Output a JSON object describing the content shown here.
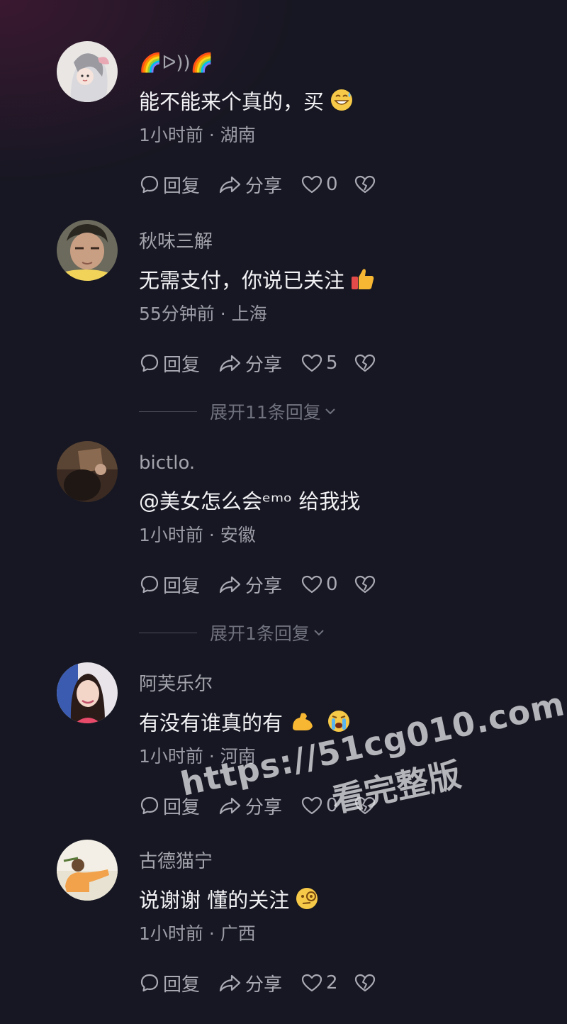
{
  "actions": {
    "reply_label": "回复",
    "share_label": "分享"
  },
  "comments": [
    {
      "username": "🌈ᐅ))🌈",
      "text": "能不能来个真的，买",
      "meta": "1小时前 · 湖南",
      "likes": "0",
      "emoji": "grinning-sweat-emoji"
    },
    {
      "username": "秋味三解",
      "text": "无需支付，你说已关注",
      "meta": "55分钟前 · 上海",
      "likes": "5",
      "emoji": "thumbs-up-emoji",
      "expand_label": "展开11条回复"
    },
    {
      "username": "bictlo.",
      "text": "@美女怎么会ᵉᵐᵒ 给我找",
      "meta": "1小时前 · 安徽",
      "likes": "0",
      "expand_label": "展开1条回复"
    },
    {
      "username": "阿芙乐尔",
      "text": "有没有谁真的有",
      "meta": "1小时前 · 河南",
      "likes": "0",
      "emoji": "muscle-and-crying-emoji"
    },
    {
      "username": "古德猫宁",
      "text": "说谢谢 懂的关注",
      "meta": "1小时前 · 广西",
      "likes": "2",
      "emoji": "monocle-face-emoji"
    }
  ],
  "watermark": {
    "url": "https://51cg010.com",
    "cta": "看完整版"
  }
}
